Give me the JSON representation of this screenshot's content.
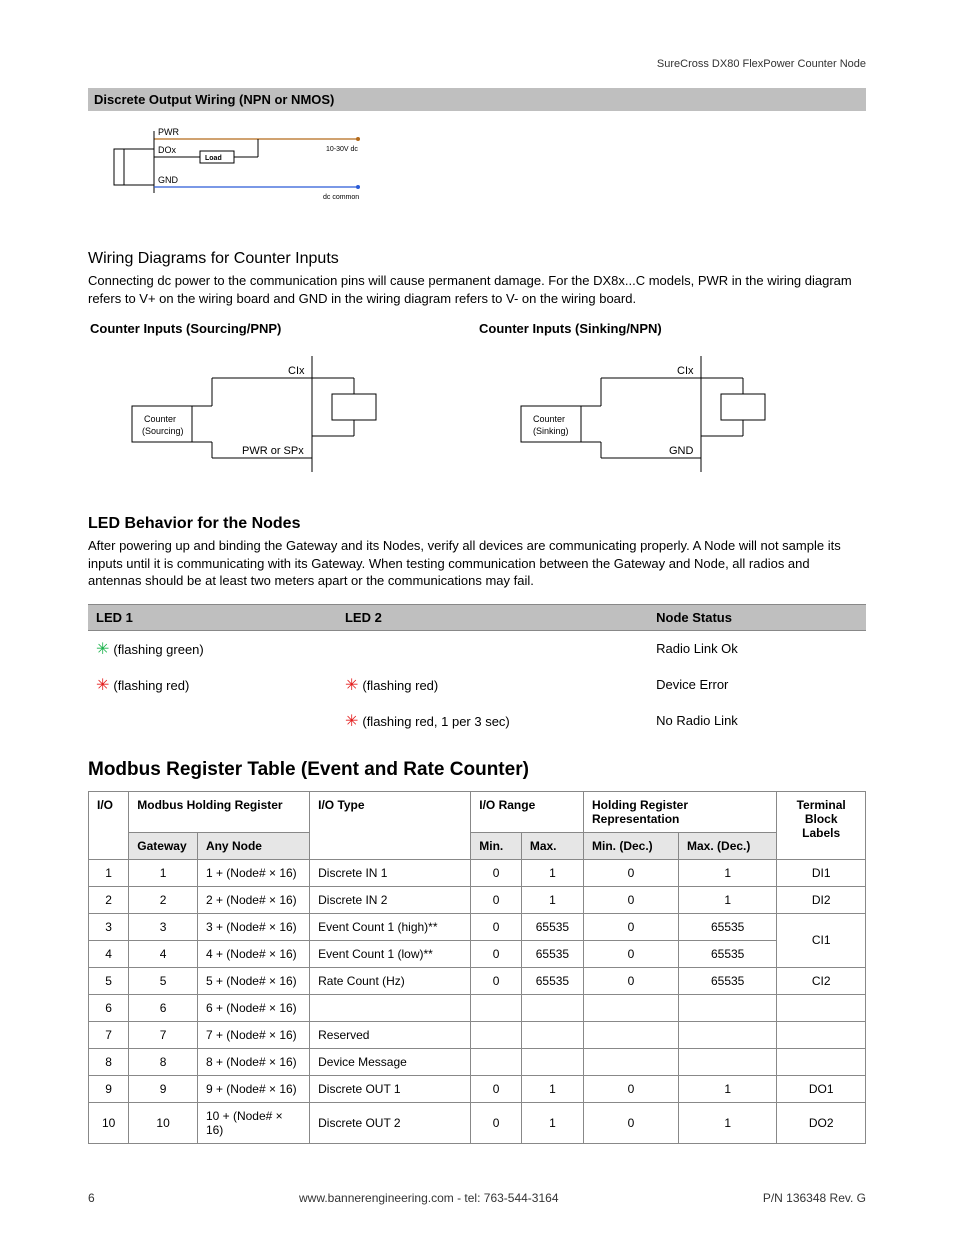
{
  "header": {
    "product": "SureCross DX80 FlexPower Counter Node"
  },
  "sections": {
    "discrete_output": "Discrete Output Wiring (NPN or NMOS)",
    "wiring_heading": "Wiring Diagrams for Counter Inputs",
    "wiring_intro": "Connecting dc power to the communication pins will cause permanent damage. For the DX8x...C models, PWR in the wiring diagram refers to V+ on the wiring board and GND in the wiring diagram refers to V- on the wiring board.",
    "ci_sourcing_title": "Counter Inputs (Sourcing/PNP)",
    "ci_sinking_title": "Counter Inputs (Sinking/NPN)",
    "led_heading": "LED Behavior for the Nodes",
    "led_intro": "After powering up and binding the Gateway and its Nodes, verify all devices are communicating properly. A Node will not sample its inputs until it is communicating with its Gateway. When testing communication between the Gateway and Node, all radios and antennas should be at least two meters apart or the communications may fail.",
    "modbus_heading": "Modbus Register Table (Event and Rate Counter)"
  },
  "discrete_diagram": {
    "pwr": "PWR",
    "dox": "DOx",
    "gnd": "GND",
    "load": "Load",
    "volt": "10-30V dc",
    "common": "dc common"
  },
  "ci_source_diagram": {
    "cix": "CIx",
    "pwr": "PWR or SPx",
    "box1": "Counter",
    "box2": "(Sourcing)"
  },
  "ci_sink_diagram": {
    "cix": "CIx",
    "gnd": "GND",
    "box1": "Counter",
    "box2": "(Sinking)"
  },
  "led_table": {
    "h_led1": "LED 1",
    "h_led2": "LED 2",
    "h_status": "Node Status",
    "rows": [
      {
        "l1_text": "(flashing green)",
        "l1_color": "green",
        "l2_text": "",
        "l2_color": "",
        "status": "Radio Link Ok"
      },
      {
        "l1_text": "(flashing red)",
        "l1_color": "red",
        "l2_text": "(flashing red)",
        "l2_color": "red",
        "status": "Device Error"
      },
      {
        "l1_text": "",
        "l1_color": "",
        "l2_text": "(flashing red, 1 per 3 sec)",
        "l2_color": "red",
        "status": "No Radio Link"
      }
    ]
  },
  "modbus": {
    "h_io": "I/O",
    "h_reg": "Modbus Holding Register",
    "h_type": "I/O Type",
    "h_range": "I/O Range",
    "h_rep": "Holding Register Representation",
    "h_tbl": "Terminal Block Labels",
    "h_gw": "Gateway",
    "h_any": "Any Node",
    "h_min": "Min.",
    "h_max": "Max.",
    "h_mind": "Min. (Dec.)",
    "h_maxd": "Max. (Dec.)",
    "rows": [
      {
        "io": "1",
        "gw": "1",
        "any": "1 + (Node# × 16)",
        "type": "Discrete IN 1",
        "rmin": "0",
        "rmax": "1",
        "dmin": "0",
        "dmax": "1",
        "tbl": "DI1"
      },
      {
        "io": "2",
        "gw": "2",
        "any": "2 + (Node# × 16)",
        "type": "Discrete IN 2",
        "rmin": "0",
        "rmax": "1",
        "dmin": "0",
        "dmax": "1",
        "tbl": "DI2"
      },
      {
        "io": "3",
        "gw": "3",
        "any": "3 + (Node# × 16)",
        "type": "Event Count 1 (high)**",
        "rmin": "0",
        "rmax": "65535",
        "dmin": "0",
        "dmax": "65535",
        "tbl": "CI1",
        "tbl_span": 2
      },
      {
        "io": "4",
        "gw": "4",
        "any": "4 + (Node# × 16)",
        "type": "Event Count 1 (low)**",
        "rmin": "0",
        "rmax": "65535",
        "dmin": "0",
        "dmax": "65535"
      },
      {
        "io": "5",
        "gw": "5",
        "any": "5 + (Node# × 16)",
        "type": "Rate Count (Hz)",
        "rmin": "0",
        "rmax": "65535",
        "dmin": "0",
        "dmax": "65535",
        "tbl": "CI2"
      },
      {
        "io": "6",
        "gw": "6",
        "any": "6 + (Node# × 16)",
        "type": "",
        "rmin": "",
        "rmax": "",
        "dmin": "",
        "dmax": "",
        "tbl": ""
      },
      {
        "io": "7",
        "gw": "7",
        "any": "7 + (Node# × 16)",
        "type": "Reserved",
        "rmin": "",
        "rmax": "",
        "dmin": "",
        "dmax": "",
        "tbl": ""
      },
      {
        "io": "8",
        "gw": "8",
        "any": "8 + (Node# × 16)",
        "type": "Device Message",
        "rmin": "",
        "rmax": "",
        "dmin": "",
        "dmax": "",
        "tbl": ""
      },
      {
        "io": "9",
        "gw": "9",
        "any": "9 + (Node# × 16)",
        "type": "Discrete OUT 1",
        "rmin": "0",
        "rmax": "1",
        "dmin": "0",
        "dmax": "1",
        "tbl": "DO1"
      },
      {
        "io": "10",
        "gw": "10",
        "any": "10 + (Node# × 16)",
        "type": "Discrete OUT 2",
        "rmin": "0",
        "rmax": "1",
        "dmin": "0",
        "dmax": "1",
        "tbl": "DO2"
      }
    ]
  },
  "footer": {
    "page": "6",
    "center": "www.bannerengineering.com - tel: 763-544-3164",
    "right": "P/N 136348 Rev. G"
  }
}
